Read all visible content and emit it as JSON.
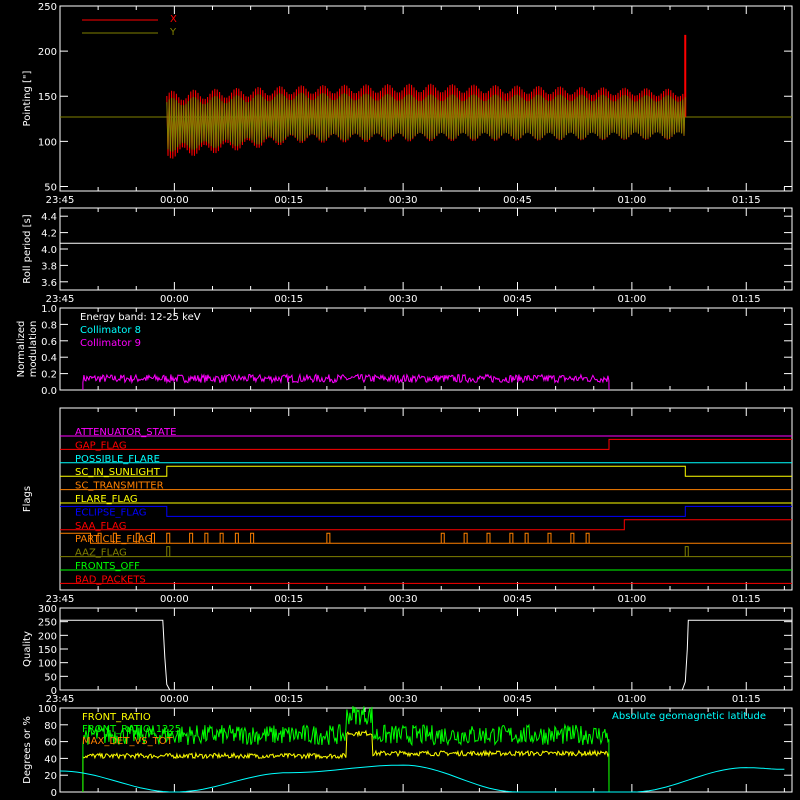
{
  "x_ticks": [
    "23:45",
    "00:00",
    "00:15",
    "00:30",
    "00:45",
    "01:00",
    "01:15"
  ],
  "colors": {
    "frame": "#ffffff",
    "x_series": "#ff0000",
    "y_series": "#808000",
    "cyan": "#00ffff",
    "magenta": "#ff00ff",
    "yellow": "#ffff00",
    "green": "#00ff00",
    "orange": "#ff8000",
    "blue": "#0000ff",
    "red": "#ff0000"
  },
  "chart_data": [
    {
      "type": "line",
      "ylabel": "Pointing [\"]",
      "ylim": [
        45,
        250
      ],
      "yticks": [
        50,
        100,
        150,
        200,
        250
      ],
      "legend": [
        "X",
        "Y"
      ],
      "baseline": 127,
      "series": [
        {
          "name": "X",
          "band_start": "23:59",
          "band_end": "01:07",
          "center": [
            118,
            130,
            132,
            131,
            130
          ],
          "amplitude": [
            38,
            32,
            32,
            30,
            28
          ],
          "spike_at": "01:07",
          "spike_value": 218
        },
        {
          "name": "Y",
          "band_start": "23:59",
          "band_end": "01:07",
          "center": [
            118,
            127,
            127,
            127,
            127
          ],
          "amplitude": [
            30,
            27,
            25,
            25,
            24
          ]
        }
      ]
    },
    {
      "type": "line",
      "ylabel": "Roll period [s]",
      "ylim": [
        3.5,
        4.5
      ],
      "yticks": [
        3.6,
        3.8,
        4.0,
        4.2,
        4.4
      ],
      "series": [
        {
          "name": "",
          "value": 4.07
        }
      ]
    },
    {
      "type": "line",
      "ylabel": "Normalized modulation",
      "ylim": [
        0,
        1.0
      ],
      "yticks": [
        0.0,
        0.2,
        0.4,
        0.6,
        0.8,
        1.0
      ],
      "annotation": "Energy band: 12-25 keV",
      "legend": [
        "Collimator 8",
        "Collimator 9"
      ],
      "series": [
        {
          "name": "Collimator 9",
          "start": "23:48",
          "end": "00:57",
          "mean": 0.14,
          "noise": 0.05
        }
      ]
    },
    {
      "type": "line",
      "ylabel": "Flags",
      "flags": [
        {
          "name": "ATTENUATOR_STATE",
          "color": "magenta",
          "segments": [
            [
              "23:45",
              "01:21",
              0
            ]
          ]
        },
        {
          "name": "GAP_FLAG",
          "color": "red",
          "segments": [
            [
              "23:45",
              "00:57",
              0
            ],
            [
              "00:57",
              "01:21",
              1
            ]
          ]
        },
        {
          "name": "POSSIBLE_FLARE",
          "color": "cyan",
          "segments": [
            [
              "23:45",
              "01:21",
              0
            ]
          ]
        },
        {
          "name": "SC_IN_SUNLIGHT",
          "color": "yellow",
          "segments": [
            [
              "23:45",
              "23:59",
              0
            ],
            [
              "23:59",
              "01:07",
              1
            ],
            [
              "01:07",
              "01:21",
              0
            ]
          ]
        },
        {
          "name": "SC_TRANSMITTER",
          "color": "orange",
          "segments": [
            [
              "23:45",
              "01:21",
              0
            ]
          ]
        },
        {
          "name": "FLARE_FLAG",
          "color": "yellow",
          "segments": [
            [
              "23:45",
              "01:21",
              0
            ]
          ]
        },
        {
          "name": "ECLIPSE_FLAG",
          "color": "blue",
          "segments": [
            [
              "23:45",
              "23:59",
              1
            ],
            [
              "23:59",
              "01:07",
              0
            ],
            [
              "01:07",
              "01:21",
              1
            ]
          ]
        },
        {
          "name": "SAA_FLAG",
          "color": "red",
          "segments": [
            [
              "23:45",
              "00:59",
              0
            ],
            [
              "00:59",
              "01:21",
              1
            ]
          ]
        },
        {
          "name": "PARTICLE_FLAG",
          "color": "orange",
          "segments": [
            [
              "23:45",
              "23:49",
              1
            ],
            [
              "23:49",
              "01:21",
              0
            ]
          ],
          "pulses": [
            "23:50",
            "23:52",
            "23:55",
            "23:57",
            "23:59",
            "00:02",
            "00:04",
            "00:06",
            "00:08",
            "00:10",
            "00:20",
            "00:35",
            "00:38",
            "00:41",
            "00:44",
            "00:46",
            "00:49",
            "00:52",
            "00:54"
          ]
        },
        {
          "name": "AAZ_FLAG",
          "color": "olive",
          "segments": [
            [
              "23:45",
              "01:21",
              0
            ]
          ],
          "pulses": [
            "23:59",
            "01:07"
          ]
        },
        {
          "name": "FRONTS_OFF",
          "color": "green",
          "segments": [
            [
              "23:45",
              "01:21",
              0
            ]
          ]
        },
        {
          "name": "BAD_PACKETS",
          "color": "red",
          "segments": [
            [
              "23:45",
              "01:21",
              0
            ]
          ]
        }
      ]
    },
    {
      "type": "line",
      "ylabel": "Quality",
      "ylim": [
        0,
        300
      ],
      "yticks": [
        0,
        50,
        100,
        150,
        200,
        250,
        300
      ],
      "series": [
        {
          "name": "",
          "high": 255,
          "drop_at": "23:59",
          "rise_at": "01:07"
        }
      ]
    },
    {
      "type": "line",
      "ylabel": "Degrees or %",
      "ylim": [
        0,
        100
      ],
      "yticks": [
        0,
        20,
        40,
        60,
        80,
        100
      ],
      "legend": [
        "FRONT_RATIO",
        "FRONT_RATIO_1225",
        "MAX_DET_VS_TOT"
      ],
      "annotation": "Absolute geomagnetic latitude",
      "series": [
        {
          "name": "FRONT_RATIO",
          "start": "23:48",
          "end": "00:57",
          "levels": [
            [
              0.0,
              0.5,
              43
            ],
            [
              0.5,
              0.55,
              70
            ],
            [
              0.55,
              1.0,
              46
            ]
          ]
        },
        {
          "name": "FRONT_RATIO_1225",
          "start": "23:48",
          "end": "00:57",
          "levels": [
            [
              0.0,
              0.5,
              68
            ],
            [
              0.5,
              0.55,
              92
            ],
            [
              0.55,
              1.0,
              68
            ]
          ]
        },
        {
          "name": "MAX_DET_VS_TOT",
          "start": "23:48",
          "end": "00:57",
          "levels": [
            [
              0.0,
              1.0,
              48
            ]
          ]
        },
        {
          "name": "Absolute geomagnetic latitude",
          "x": [
            "23:45",
            "00:00",
            "00:15",
            "00:30",
            "00:45",
            "01:00",
            "01:15",
            "01:20"
          ],
          "y": [
            25,
            0,
            23,
            32,
            0,
            0,
            29,
            27
          ]
        }
      ]
    }
  ]
}
